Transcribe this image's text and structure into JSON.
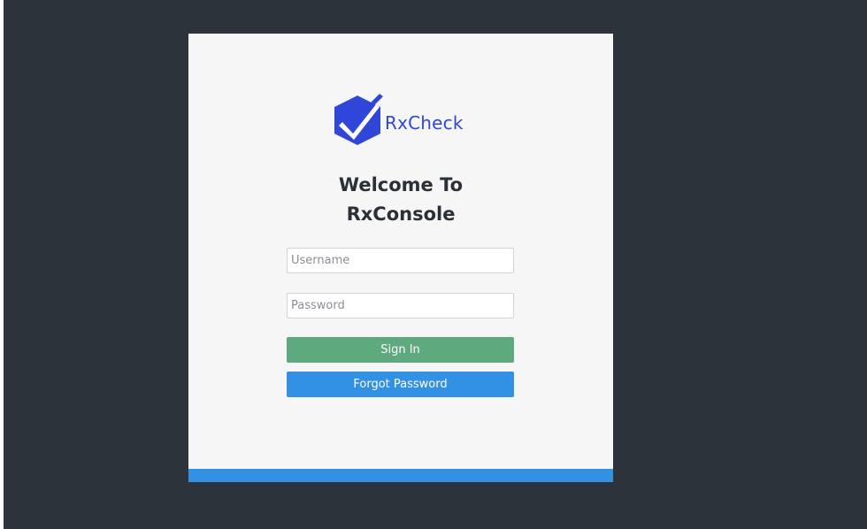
{
  "brand": {
    "name": "RxCheck",
    "logo_icon": "shield-check-icon"
  },
  "login": {
    "title_line1": "Welcome To",
    "title_line2": "RxConsole",
    "username_placeholder": "Username",
    "username_value": "",
    "password_placeholder": "Password",
    "password_value": "",
    "signin_label": "Sign In",
    "forgot_label": "Forgot Password"
  },
  "colors": {
    "background": "#2d333b",
    "card": "#f6f6f6",
    "brand_blue": "#2f46d8",
    "title_text": "#2b3036",
    "signin_button": "#5ea97e",
    "forgot_button": "#3391e3",
    "footer_bar": "#3391e3"
  }
}
